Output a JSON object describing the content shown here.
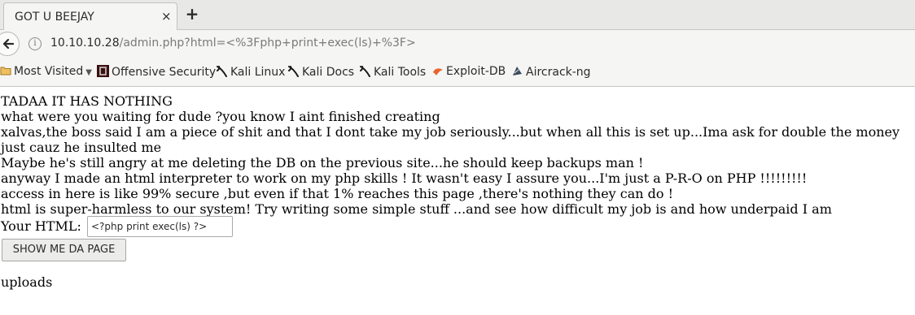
{
  "tab": {
    "title": "GOT U BEEJAY",
    "close": "×",
    "new_tab": "+"
  },
  "navbar": {
    "url_host": "10.10.10.28",
    "url_path": "/admin.php?html=<%3Fphp+print+exec(ls)+%3F>"
  },
  "bookmarks": [
    {
      "label": "Most Visited",
      "icon": "folder-icon",
      "has_dropdown": true
    },
    {
      "label": "Offensive Security",
      "icon": "offsec-icon"
    },
    {
      "label": "Kali Linux",
      "icon": "kali-dragon-icon"
    },
    {
      "label": "Kali Docs",
      "icon": "kali-dragon-icon"
    },
    {
      "label": "Kali Tools",
      "icon": "kali-dragon-icon"
    },
    {
      "label": "Exploit-DB",
      "icon": "exploitdb-icon"
    },
    {
      "label": "Aircrack-ng",
      "icon": "aircrack-icon"
    }
  ],
  "content": {
    "lines": [
      "TADAA IT HAS NOTHING",
      "what were you waiting for dude ?you know I aint finished creating",
      "xalvas,the boss said I am a piece of shit and that I dont take my job seriously...but when all this is set up...Ima ask for double the money",
      "just cauz he insulted me",
      "Maybe he's still angry at me deleting the DB on the previous site...he should keep backups man !",
      "anyway I made an html interpreter to work on my php skills ! It wasn't easy I assure you...I'm just a P-R-O on PHP !!!!!!!!!",
      "access in here is like 99% secure ,but even if that 1% reaches this page ,there's nothing they can do !",
      "html is super-harmless to our system! Try writing some simple stuff ...and see how difficult my job is and how underpaid I am"
    ],
    "html_label": "Your HTML:",
    "html_input_value": "<?php print exec(ls) ?>",
    "submit_label": "SHOW ME DA PAGE",
    "uploads_link": "uploads"
  }
}
